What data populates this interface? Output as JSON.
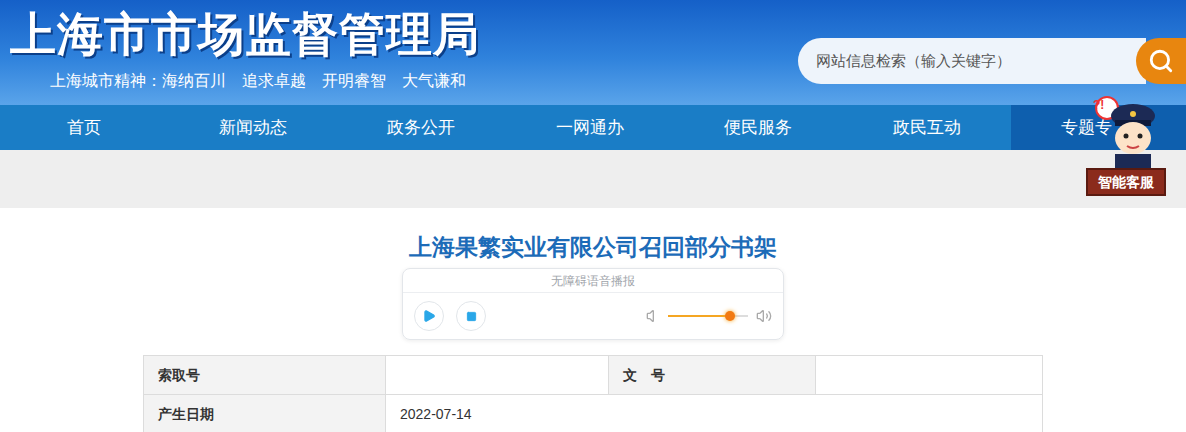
{
  "header": {
    "title": "上海市市场监督管理局",
    "slogan": "上海城市精神：海纳百川　追求卓越　开明睿智　大气谦和",
    "search": {
      "placeholder": "网站信息检索（输入关键字）"
    }
  },
  "nav": [
    {
      "label": "首页",
      "selected": false
    },
    {
      "label": "新闻动态",
      "selected": false
    },
    {
      "label": "政务公开",
      "selected": false
    },
    {
      "label": "一网通办",
      "selected": false
    },
    {
      "label": "便民服务",
      "selected": false
    },
    {
      "label": "政民互动",
      "selected": false
    },
    {
      "label": "专题专",
      "selected": true
    }
  ],
  "assistant": {
    "label": "智能客服",
    "badge": "?!"
  },
  "article": {
    "title": "上海果繁实业有限公司召回部分书架"
  },
  "player": {
    "label": "无障碍语音播报",
    "volume": 0.78
  },
  "info_table": {
    "rows": [
      [
        {
          "label": "索取号",
          "value": ""
        },
        {
          "label": "文　号",
          "value": ""
        }
      ],
      [
        {
          "label": "产生日期",
          "value": "2022-07-14"
        }
      ]
    ]
  }
}
